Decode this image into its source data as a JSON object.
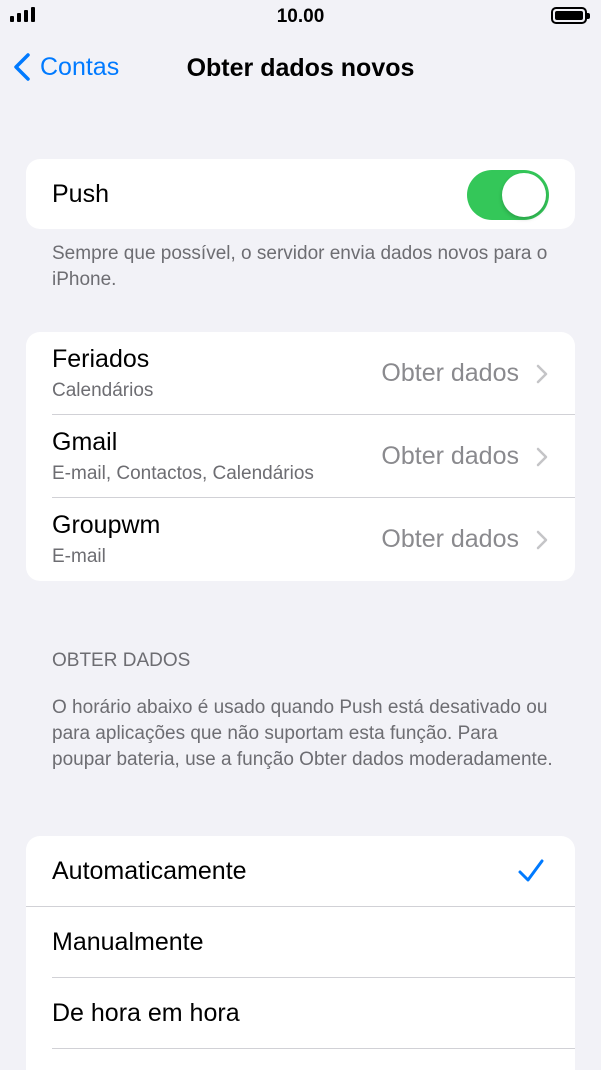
{
  "status_bar": {
    "time": "10.00"
  },
  "nav": {
    "back_label": "Contas",
    "title": "Obter dados novos"
  },
  "push": {
    "label": "Push",
    "enabled": true,
    "footnote": "Sempre que possível, o servidor envia dados novos para o iPhone."
  },
  "accounts": [
    {
      "name": "Feriados",
      "subtitle": "Calendários",
      "value": "Obter dados"
    },
    {
      "name": "Gmail",
      "subtitle": "E-mail, Contactos, Calendários",
      "value": "Obter dados"
    },
    {
      "name": "Groupwm",
      "subtitle": "E-mail",
      "value": "Obter dados"
    }
  ],
  "fetch": {
    "header": "OBTER DADOS",
    "description": "O horário abaixo é usado quando Push está desativado ou para aplicações que não suportam esta função. Para poupar bateria, use a função Obter dados moderadamente.",
    "options": [
      {
        "label": "Automaticamente",
        "selected": true
      },
      {
        "label": "Manualmente",
        "selected": false
      },
      {
        "label": "De hora em hora",
        "selected": false
      }
    ]
  },
  "colors": {
    "accent": "#007aff",
    "toggle_on": "#34c759",
    "background": "#f2f2f7"
  },
  "icons": {
    "back": "chevron-left-icon",
    "disclosure": "chevron-right-icon",
    "selected": "checkmark-icon"
  }
}
